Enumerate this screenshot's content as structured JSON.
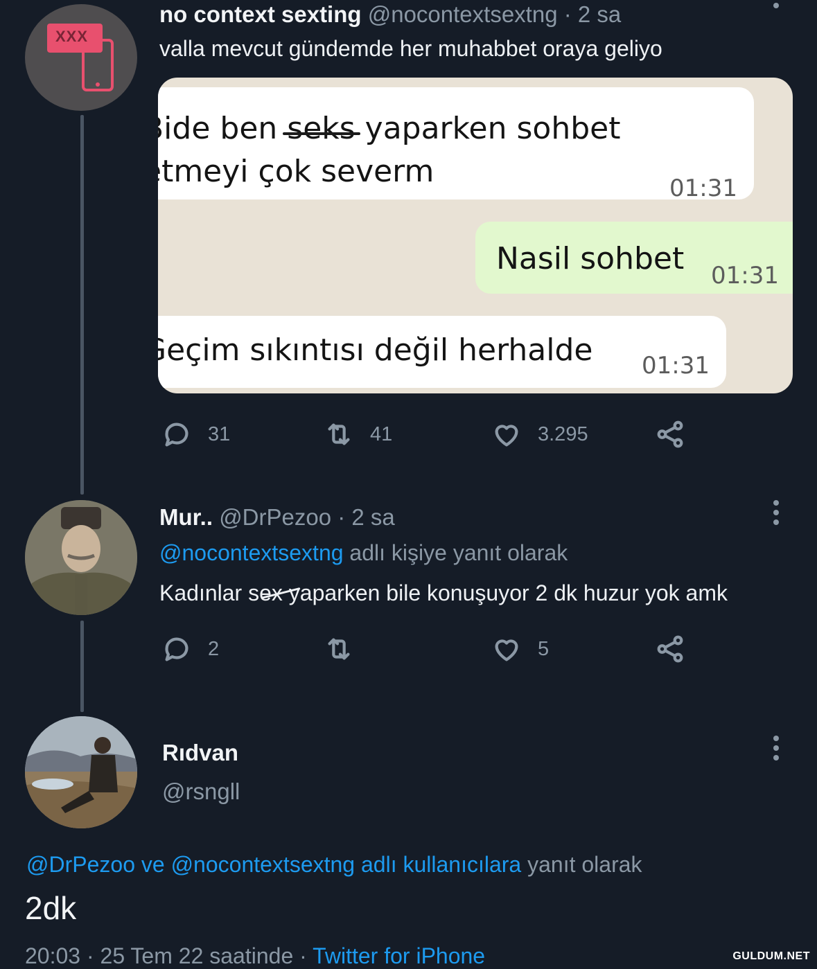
{
  "tweet1": {
    "display_name": "no context sexting",
    "handle": "@nocontextsextng",
    "time": "· 2 sa",
    "text": "valla mevcut gündemde her muhabbet oraya geliyo",
    "avatar_badge": "XXX",
    "chat": {
      "msg1_line1": "Bide ben seks yaparken sohbet",
      "msg1_line2": "etmeyi çok severm",
      "msg1_time": "01:31",
      "msg2": "Nasil sohbet",
      "msg2_time": "01:31",
      "msg3": "Geçim sıkıntısı değil herhalde",
      "msg3_time": "01:31"
    },
    "stats": {
      "replies": "31",
      "retweets": "41",
      "likes": "3.295"
    }
  },
  "tweet2": {
    "display_name": "Mur..",
    "handle": "@DrPezoo",
    "time": "· 2 sa",
    "reply_to_handle": "@nocontextsextng",
    "reply_to_suffix": "adlı kişiye yanıt olarak",
    "text": "Kadınlar sex yaparken bile konuşuyor 2 dk huzur yok amk",
    "stats": {
      "replies": "2",
      "retweets": "",
      "likes": "5"
    }
  },
  "tweet3": {
    "display_name": "Rıdvan",
    "handle": "@rsngll",
    "reply_to_handles": "@DrPezoo ve @nocontextsextng adlı kullanıcılara",
    "reply_to_suffix": "yanıt olarak",
    "text": "2dk",
    "timestamp": "20:03 · 25 Tem 22 saatinde ·",
    "source": "Twitter for iPhone"
  },
  "watermark": "GULDUM.NET",
  "icons": [
    "reply-icon",
    "retweet-icon",
    "like-icon",
    "share-icon",
    "more-icon"
  ],
  "colors": {
    "background": "#151c27",
    "link": "#1d9bf0",
    "muted": "#8b98a5"
  }
}
